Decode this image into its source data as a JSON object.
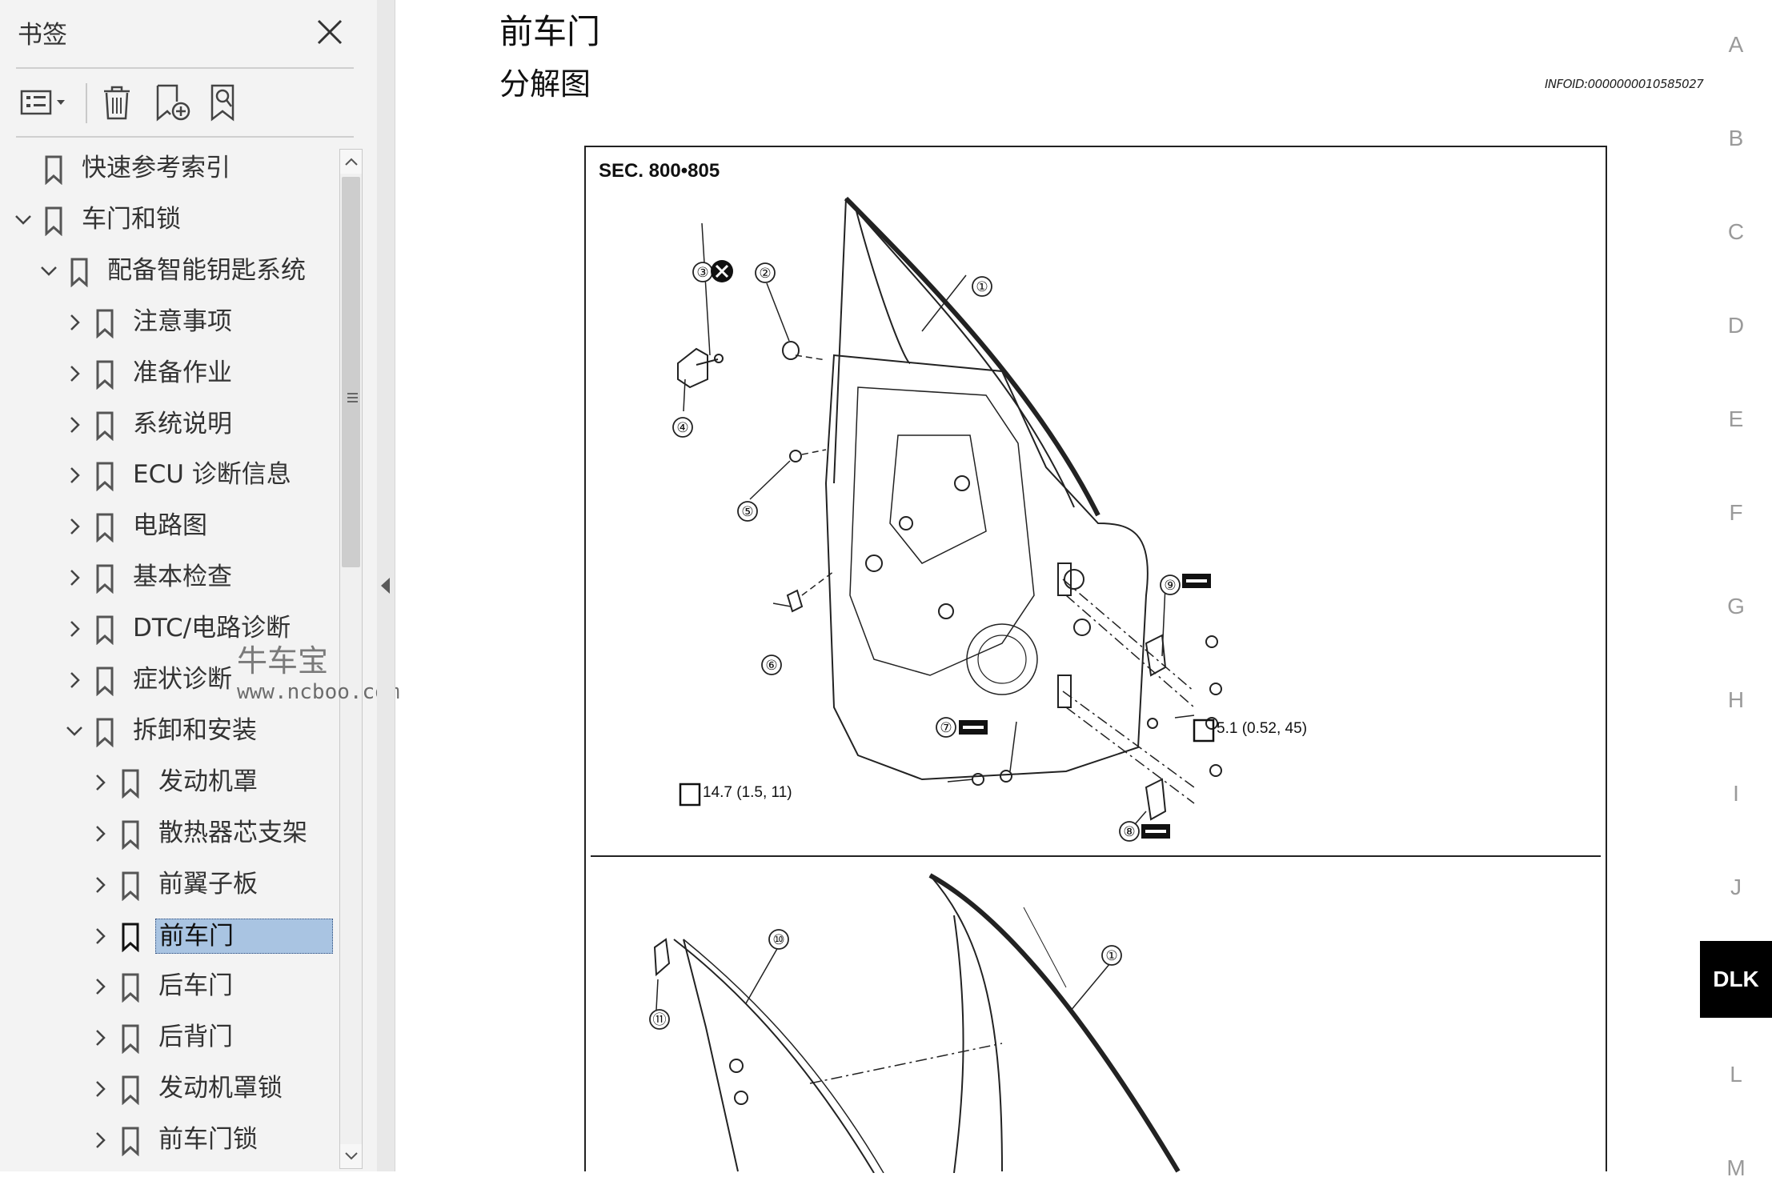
{
  "sidebar": {
    "title": "书签",
    "toolbar": [
      {
        "name": "options-menu-icon"
      },
      {
        "name": "delete-icon"
      },
      {
        "name": "new-bookmark-icon"
      },
      {
        "name": "bookmark-search-icon"
      }
    ],
    "tree": [
      {
        "label": "快速参考索引",
        "level": 0,
        "chevron": "none"
      },
      {
        "label": "车门和锁",
        "level": 0,
        "chevron": "down"
      },
      {
        "label": "配备智能钥匙系统",
        "level": 1,
        "chevron": "down"
      },
      {
        "label": "注意事项",
        "level": 2,
        "chevron": "right"
      },
      {
        "label": "准备作业",
        "level": 2,
        "chevron": "right"
      },
      {
        "label": "系统说明",
        "level": 2,
        "chevron": "right"
      },
      {
        "label": "ECU 诊断信息",
        "level": 2,
        "chevron": "right"
      },
      {
        "label": "电路图",
        "level": 2,
        "chevron": "right"
      },
      {
        "label": "基本检查",
        "level": 2,
        "chevron": "right"
      },
      {
        "label": "DTC/电路诊断",
        "level": 2,
        "chevron": "right"
      },
      {
        "label": "症状诊断",
        "level": 2,
        "chevron": "right"
      },
      {
        "label": "拆卸和安装",
        "level": 2,
        "chevron": "down"
      },
      {
        "label": "发动机罩",
        "level": 3,
        "chevron": "right"
      },
      {
        "label": "散热器芯支架",
        "level": 3,
        "chevron": "right"
      },
      {
        "label": "前翼子板",
        "level": 3,
        "chevron": "right"
      },
      {
        "label": "前车门",
        "level": 3,
        "chevron": "right",
        "selected": true
      },
      {
        "label": "后车门",
        "level": 3,
        "chevron": "right"
      },
      {
        "label": "后背门",
        "level": 3,
        "chevron": "right"
      },
      {
        "label": "发动机罩锁",
        "level": 3,
        "chevron": "right"
      },
      {
        "label": "前车门锁",
        "level": 3,
        "chevron": "right"
      }
    ]
  },
  "watermark": {
    "brand": "牛车宝",
    "url": "www.ncboo.com"
  },
  "document": {
    "title": "前车门",
    "subtitle": "分解图",
    "info_id": "INFOID:0000000010585027",
    "figure": {
      "section": "SEC. 800•805",
      "callouts": [
        "①",
        "②",
        "③",
        "④",
        "⑤",
        "⑥",
        "⑦",
        "⑧",
        "⑨",
        "⑩",
        "⑪"
      ],
      "torque_a": "5.1 (0.52, 45)",
      "torque_b": "14.7 (1.5, 11)"
    }
  },
  "section_index": [
    "A",
    "B",
    "C",
    "D",
    "E",
    "F",
    "G",
    "H",
    "I",
    "J",
    "DLK",
    "L",
    "M"
  ],
  "active_section": "DLK",
  "colors": {
    "selection": "#a9c4e2",
    "sidebar_bg": "#f3f3f3",
    "index_active": "#000000"
  }
}
